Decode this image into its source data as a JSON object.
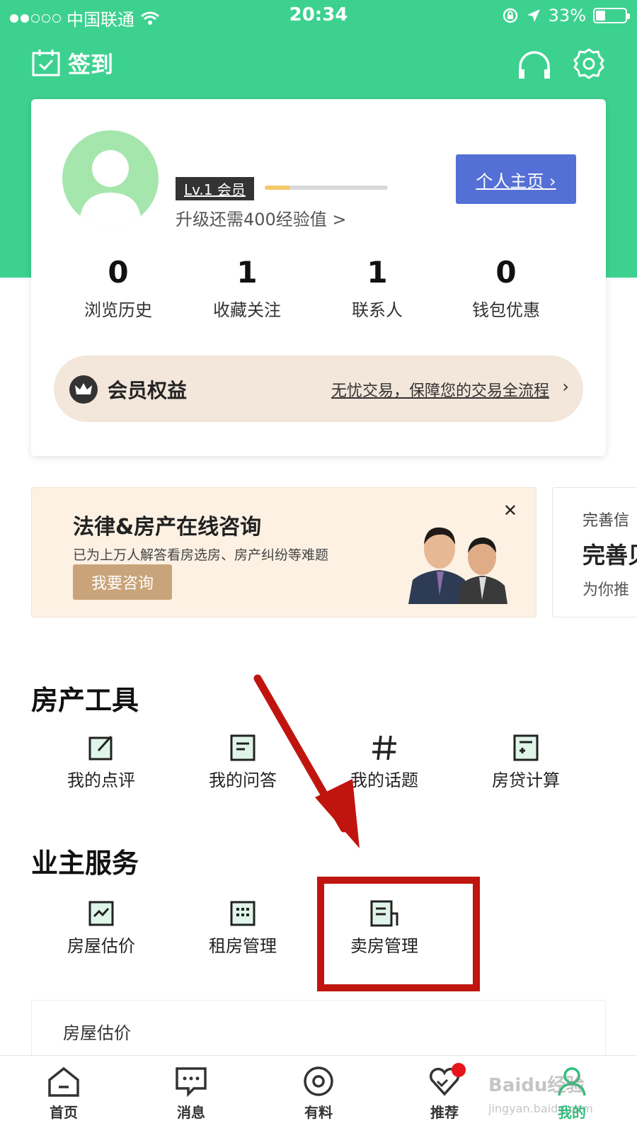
{
  "status_bar": {
    "carrier": "中国联通",
    "time": "20:34",
    "battery_text": "33%",
    "battery_level": 0.33
  },
  "header": {
    "checkin_label": "签到"
  },
  "profile": {
    "level_badge": "Lv.1 会员",
    "level_progress": 0.2,
    "upgrade_hint": "升级还需400经验值 >",
    "homepage_button": "个人主页 ›"
  },
  "stats": [
    {
      "value": "0",
      "label": "浏览历史"
    },
    {
      "value": "1",
      "label": "收藏关注"
    },
    {
      "value": "1",
      "label": "联系人"
    },
    {
      "value": "0",
      "label": "钱包优惠"
    }
  ],
  "vip": {
    "title": "会员权益",
    "description": "无忧交易，保障您的交易全流程",
    "chevron": "›"
  },
  "banner": {
    "title": "法律&房产在线咨询",
    "subtitle": "已为上万人解答看房选房、房产纠纷等难题",
    "button": "我要咨询",
    "close": "✕"
  },
  "banner2": {
    "line1": "完善信",
    "line2": "完善贝",
    "line3": "为你推"
  },
  "property_tools": {
    "title": "房产工具",
    "items": [
      {
        "label": "我的点评",
        "icon": "edit-icon"
      },
      {
        "label": "我的问答",
        "icon": "document-icon"
      },
      {
        "label": "我的话题",
        "icon": "hashtag-icon"
      },
      {
        "label": "房贷计算",
        "icon": "calculator-icon"
      }
    ]
  },
  "owner_services": {
    "title": "业主服务",
    "items": [
      {
        "label": "房屋估价",
        "icon": "chart-icon"
      },
      {
        "label": "租房管理",
        "icon": "building-icon"
      },
      {
        "label": "卖房管理",
        "icon": "sell-house-icon"
      }
    ]
  },
  "estimate_card": {
    "title": "房屋估价"
  },
  "tabs": [
    {
      "label": "首页",
      "icon": "home-icon"
    },
    {
      "label": "消息",
      "icon": "message-icon"
    },
    {
      "label": "有料",
      "icon": "discover-icon"
    },
    {
      "label": "推荐",
      "icon": "recommend-icon"
    },
    {
      "label": "我的",
      "icon": "profile-icon"
    }
  ],
  "watermark": {
    "text": "Baidu经验",
    "url_text": "jingyan.baidu.com"
  },
  "colors": {
    "brand_green": "#3dd18f",
    "button_blue": "#5470d6",
    "highlight_red": "#c0150f"
  }
}
